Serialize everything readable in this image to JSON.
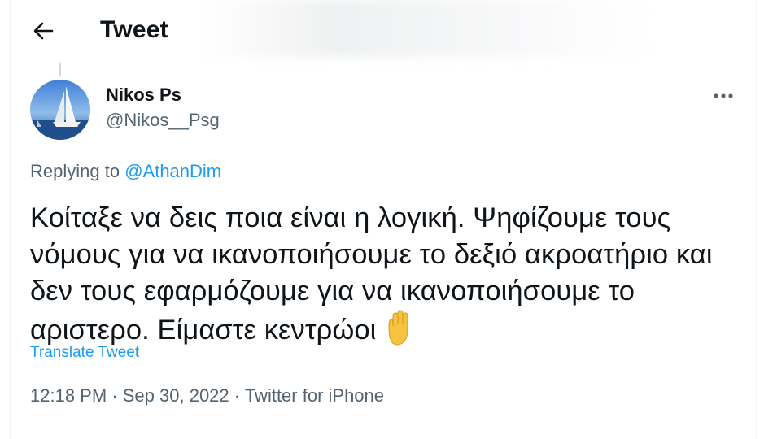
{
  "header": {
    "title": "Tweet",
    "back_icon": "arrow-left-icon"
  },
  "tweet": {
    "author": {
      "name": "Nikos Ps",
      "handle": "@Nikos__Psg",
      "avatar_icon": "sailboat-avatar"
    },
    "replying_prefix": "Replying to",
    "replying_to": "@AthanDim",
    "text": "Κοίταξε να δεις ποια είναι η λογική. Ψηφίζουμε τους νόμους για να ικανοποιήσουμε το δεξιό ακροατήριο και δεν τους εφαρμόζουμε για να ικανοποιήσουμε το αριστερο. Είμαστε κεντρώοι",
    "emoji_icon": "raised-hand-emoji",
    "translate_label": "Translate Tweet",
    "time": "12:18 PM",
    "date": "Sep 30, 2022",
    "source": "Twitter for iPhone",
    "separator": "·"
  },
  "colors": {
    "link_blue": "#1d9bf0",
    "secondary_text": "#536471",
    "primary_text": "#0f1419"
  }
}
